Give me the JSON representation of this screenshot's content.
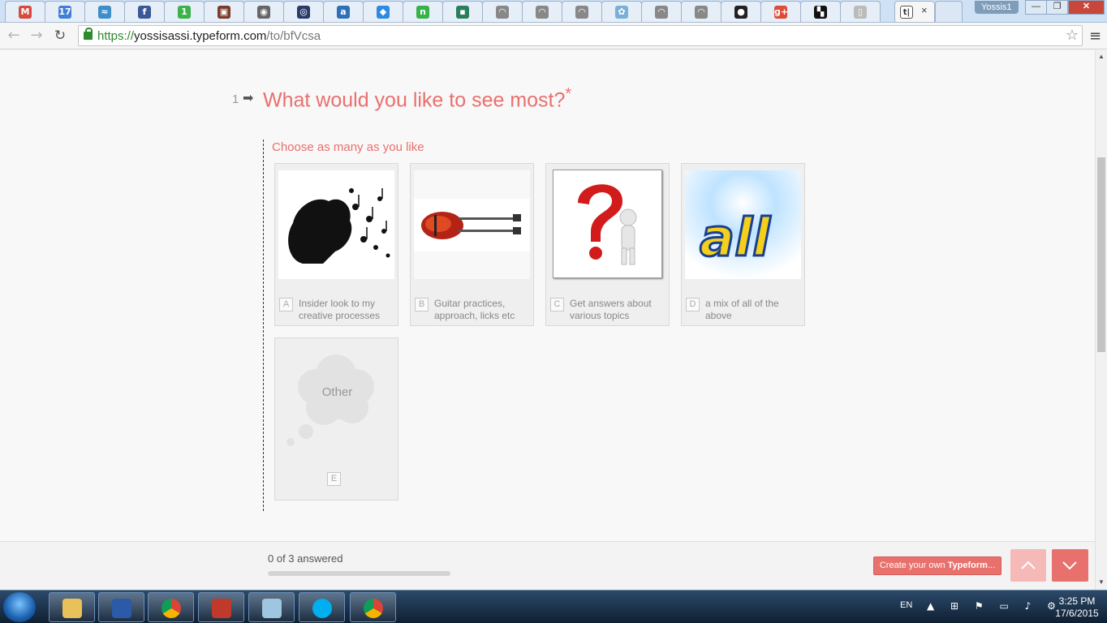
{
  "browser": {
    "tabs": [
      {
        "icon": "gmail-icon",
        "glyph": "M",
        "color": "#d54b3d"
      },
      {
        "icon": "calendar-icon",
        "glyph": "17",
        "color": "#3f7fd8"
      },
      {
        "icon": "tab-app-icon",
        "glyph": "≈",
        "color": "#3d8ec9"
      },
      {
        "icon": "facebook-icon",
        "glyph": "f",
        "color": "#3b5998"
      },
      {
        "icon": "tab-app-icon",
        "glyph": "1",
        "color": "#3bb24a"
      },
      {
        "icon": "tab-app-icon",
        "glyph": "▣",
        "color": "#7a3b2a"
      },
      {
        "icon": "tab-app-icon",
        "glyph": "◉",
        "color": "#666666"
      },
      {
        "icon": "tab-app-icon",
        "glyph": "◎",
        "color": "#2a3b6a"
      },
      {
        "icon": "tab-app-icon",
        "glyph": "a",
        "color": "#2e6fb8"
      },
      {
        "icon": "dropbox-icon",
        "glyph": "◆",
        "color": "#2d8ae0"
      },
      {
        "icon": "tab-app-icon",
        "glyph": "n",
        "color": "#36b24a"
      },
      {
        "icon": "tab-app-icon",
        "glyph": "▪",
        "color": "#2d7f5c"
      },
      {
        "icon": "feed-icon",
        "glyph": "◠",
        "color": "#888888"
      },
      {
        "icon": "feed-icon",
        "glyph": "◠",
        "color": "#888888"
      },
      {
        "icon": "feed-icon",
        "glyph": "◠",
        "color": "#888888"
      },
      {
        "icon": "tab-app-icon",
        "glyph": "✿",
        "color": "#7ab0d8"
      },
      {
        "icon": "feed-icon",
        "glyph": "◠",
        "color": "#888888"
      },
      {
        "icon": "feed-icon",
        "glyph": "◠",
        "color": "#888888"
      },
      {
        "icon": "tab-app-icon",
        "glyph": "●",
        "color": "#222222"
      },
      {
        "icon": "google-plus-icon",
        "glyph": "g+",
        "color": "#dd4b39"
      },
      {
        "icon": "tab-app-icon",
        "glyph": "▚",
        "color": "#111111"
      },
      {
        "icon": "page-icon",
        "glyph": "▯",
        "color": "#bbbbbb"
      }
    ],
    "active_tab": {
      "glyph": "t|",
      "close": "×"
    },
    "profile_name": "Yossis1",
    "window_buttons": {
      "minimize": "—",
      "maximize": "❐",
      "close": "✕"
    },
    "url": {
      "scheme": "https://",
      "host": "yossisassi.typeform.com",
      "path": "/to/bfVcsa"
    }
  },
  "form": {
    "question_number": "1",
    "question_arrow": "➡",
    "question_text": "What would you like to see most?",
    "required_mark": "*",
    "hint": "Choose as many as you like",
    "choices": [
      {
        "letter": "A",
        "label": "Insider look to my creative processes"
      },
      {
        "letter": "B",
        "label": "Guitar practices, approach, licks etc"
      },
      {
        "letter": "C",
        "label": "Get answers about various topics"
      },
      {
        "letter": "D",
        "label": "a mix of all of the above"
      }
    ],
    "other": {
      "letter": "E",
      "label": "Other"
    },
    "images": {
      "d_logo_text": "all"
    }
  },
  "footer": {
    "progress_text": "0 of 3 answered",
    "progress_fraction": 0,
    "create_button_prefix": "Create your own",
    "create_button_brand": "Typeform",
    "create_button_suffix": "..."
  },
  "taskbar": {
    "language": "EN",
    "time": "3:25 PM",
    "date": "17/6/2015"
  },
  "colors": {
    "accent": "#e8706d",
    "progress_track": "#d4d4d4"
  }
}
